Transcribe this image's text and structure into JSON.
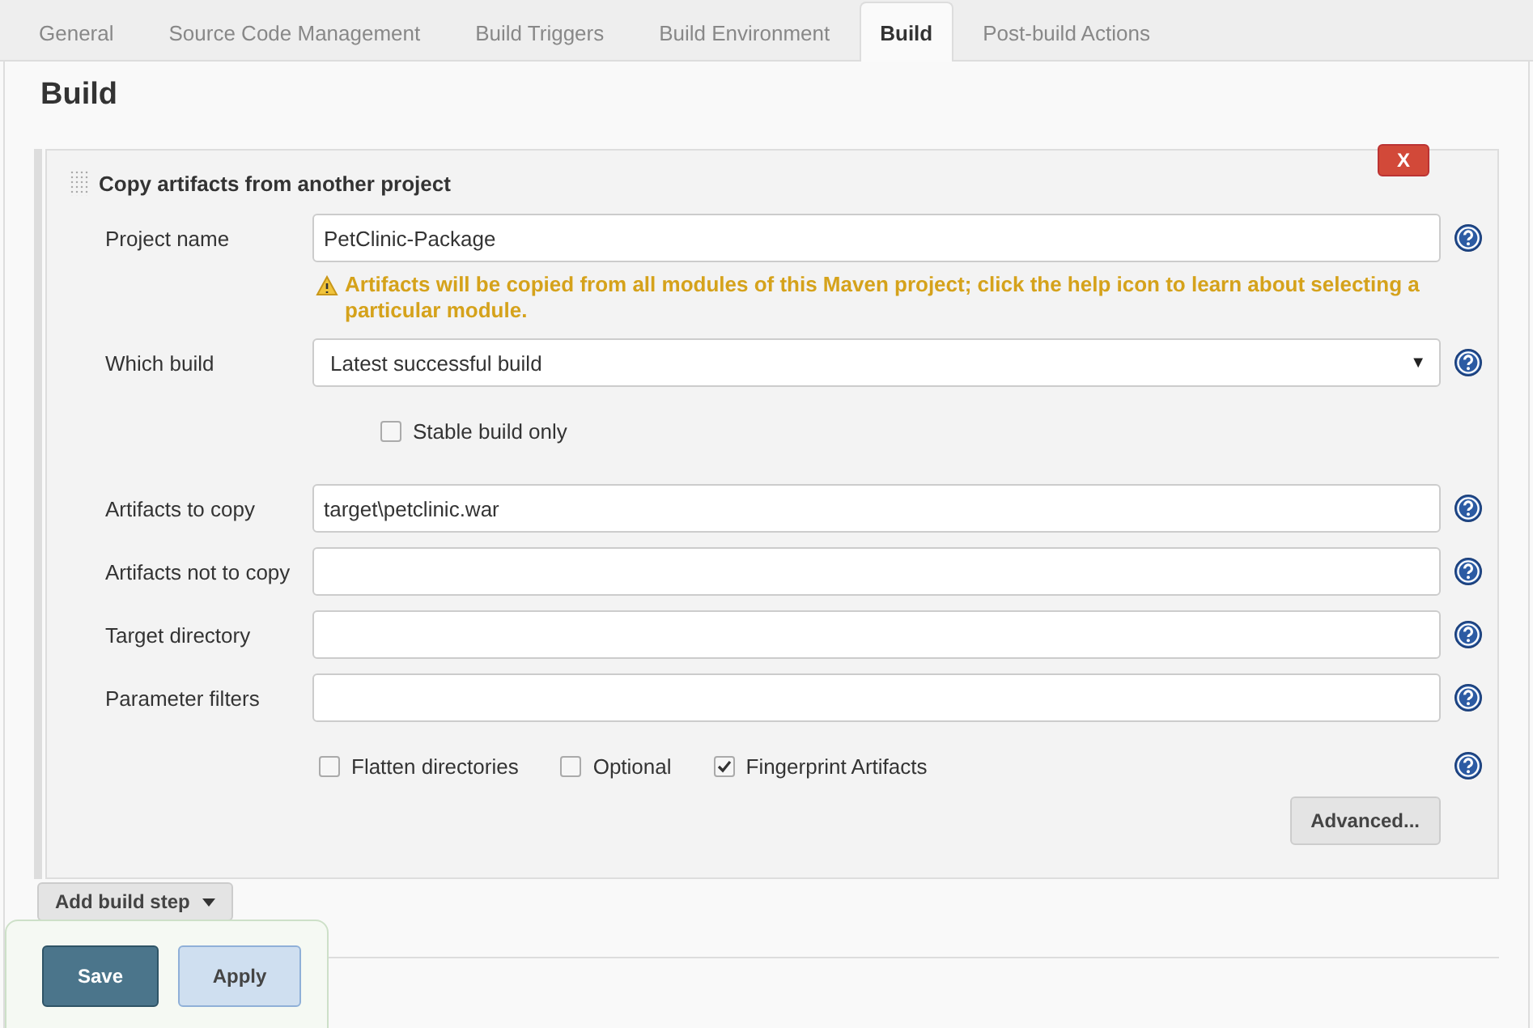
{
  "tabs": [
    {
      "label": "General",
      "selected": false
    },
    {
      "label": "Source Code Management",
      "selected": false
    },
    {
      "label": "Build Triggers",
      "selected": false
    },
    {
      "label": "Build Environment",
      "selected": false
    },
    {
      "label": "Build",
      "selected": true
    },
    {
      "label": "Post-build Actions",
      "selected": false
    }
  ],
  "section_title": "Build",
  "build_step": {
    "title": "Copy artifacts from another project",
    "delete_button": "X",
    "fields": [
      {
        "label": "Project name",
        "kind": "text",
        "value": "PetClinic-Package",
        "warning": "Artifacts will be copied from all modules of this Maven project; click the help icon to learn about selecting a particular module."
      },
      {
        "label": "Which build",
        "kind": "select",
        "value": "Latest successful build",
        "arrow": "▼",
        "option": {
          "label": "Stable build only",
          "checked": false
        }
      },
      {
        "label": "Artifacts to copy",
        "kind": "text",
        "value": "target\\petclinic.war"
      },
      {
        "label": "Artifacts not to copy",
        "kind": "text"
      },
      {
        "label": "Target directory",
        "kind": "text"
      },
      {
        "label": "Parameter filters",
        "kind": "text"
      }
    ],
    "options": [
      {
        "label": "Flatten directories",
        "checked": false
      },
      {
        "label": "Optional",
        "checked": false
      },
      {
        "label": "Fingerprint Artifacts",
        "checked": true
      }
    ],
    "advanced_button": "Advanced..."
  },
  "add_build_step": "Add build step",
  "buttons": [
    {
      "label": "Save",
      "kind": "primary"
    },
    {
      "label": "Apply",
      "kind": "secondary"
    }
  ]
}
